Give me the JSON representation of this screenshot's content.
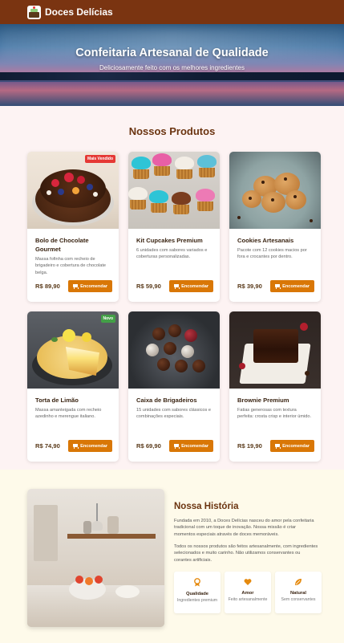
{
  "brand": {
    "name": "Doces Delícias"
  },
  "hero": {
    "title": "Confeitaria Artesanal de Qualidade",
    "subtitle": "Deliciosamente feito com os melhores ingredientes"
  },
  "products": {
    "heading": "Nossos Produtos",
    "order_label": "Encomendar",
    "items": [
      {
        "name": "Bolo de Chocolate Gourmet",
        "description": "Massa fofinha com recheio de brigadeiro e cobertura de chocolate belga.",
        "price": "R$ 89,90",
        "badge": "Mais Vendido",
        "badge_color": "#e53935",
        "image_icon": "chocolate-cake"
      },
      {
        "name": "Kit Cupcakes Premium",
        "description": "6 unidades com sabores variados e coberturas personalizadas.",
        "price": "R$ 59,90",
        "badge": "",
        "image_icon": "cupcakes"
      },
      {
        "name": "Cookies Artesanais",
        "description": "Pacote com 12 cookies macios por fora e crocantes por dentro.",
        "price": "R$ 39,90",
        "badge": "",
        "image_icon": "cookies"
      },
      {
        "name": "Torta de Limão",
        "description": "Massa amanteigada com recheio azedinho e merengue italiano.",
        "price": "R$ 74,90",
        "badge": "Novo",
        "badge_color": "#43a047",
        "image_icon": "lemon-tart"
      },
      {
        "name": "Caixa de Brigadeiros",
        "description": "15 unidades com sabores clássicos e combinações especiais.",
        "price": "R$ 69,90",
        "badge": "",
        "image_icon": "brigadeiros"
      },
      {
        "name": "Brownie Premium",
        "description": "Fatias generosas com textura perfeita: crosta crisp e interior úmido.",
        "price": "R$ 19,90",
        "badge": "",
        "image_icon": "brownie"
      }
    ]
  },
  "story": {
    "title": "Nossa História",
    "paragraphs": [
      "Fundada em 2010, a Doces Delícias nasceu do amor pela confeitaria tradicional com um toque de inovação. Nossa missão é criar momentos especiais através de doces memoráveis.",
      "Todos os nossos produtos são feitos artesanalmente, com ingredientes selecionados e muito carinho. Não utilizamos conservantes ou corantes artificiais."
    ],
    "values": [
      {
        "title": "Qualidade",
        "subtitle": "Ingredientes premium",
        "icon": "award-icon"
      },
      {
        "title": "Amor",
        "subtitle": "Feito artesanalmente",
        "icon": "heart-icon"
      },
      {
        "title": "Natural",
        "subtitle": "Sem conservantes",
        "icon": "leaf-icon"
      }
    ]
  },
  "colors": {
    "header": "#7a3411",
    "accent": "#d97706",
    "heading": "#6b3410"
  }
}
